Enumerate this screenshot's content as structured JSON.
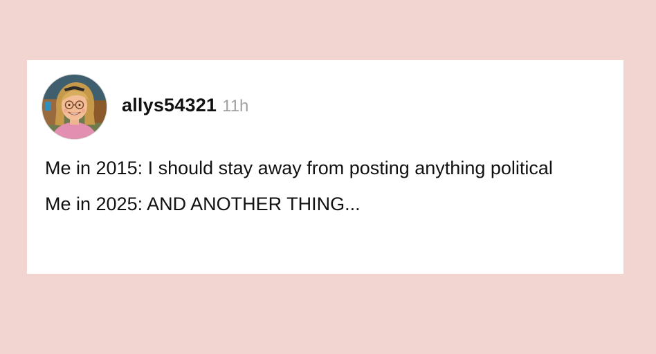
{
  "post": {
    "author": {
      "username": "allys54321",
      "avatar": "avatar-illustration"
    },
    "timestamp": "11h",
    "lines": [
      "Me in 2015: I should stay away from posting anything political",
      "Me in 2025: AND ANOTHER THING..."
    ]
  },
  "colors": {
    "page_background": "#f2d5d1",
    "card_background": "#ffffff",
    "username": "#111111",
    "timestamp": "#a0a0a0"
  }
}
